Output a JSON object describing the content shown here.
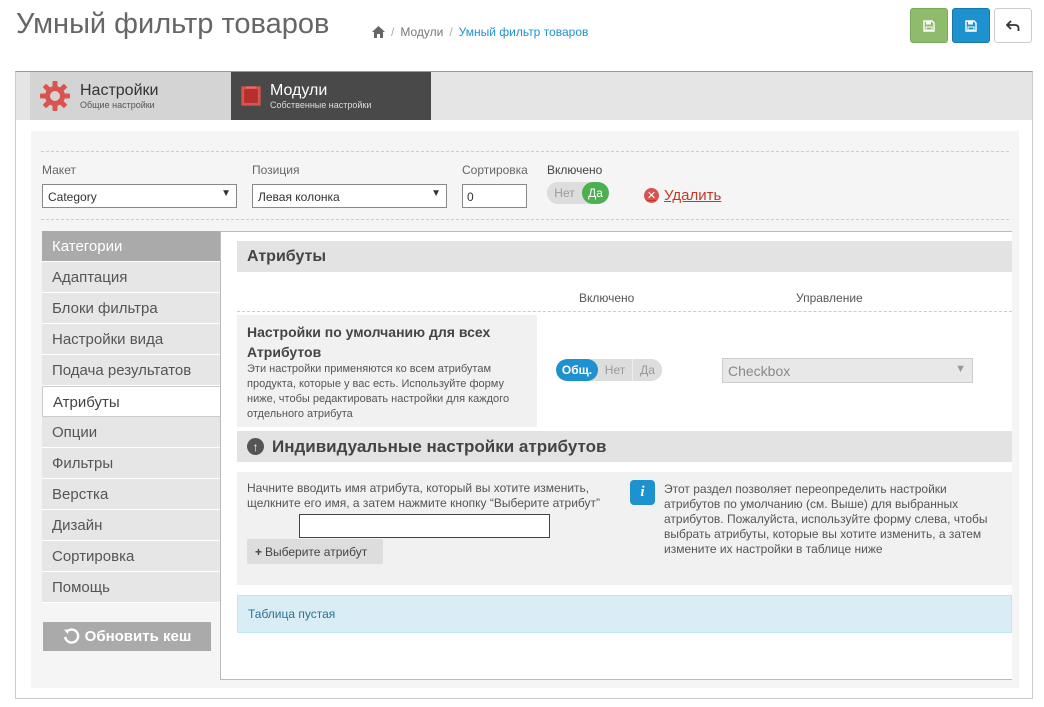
{
  "header": {
    "title": "Умный фильтр товаров",
    "breadcrumb": [
      "Модули",
      "Умный фильтр товаров"
    ]
  },
  "topnav": {
    "settings": {
      "title": "Настройки",
      "subtitle": "Общие настройки"
    },
    "modules": {
      "title": "Модули",
      "subtitle": "Собственные настройки"
    }
  },
  "layout_row": {
    "layout_label": "Макет",
    "layout_value": "Category",
    "position_label": "Позиция",
    "position_value": "Левая колонка",
    "sort_label": "Сортировка",
    "sort_value": "0",
    "enabled_label": "Включено",
    "toggle_no": "Нет",
    "toggle_yes": "Да",
    "delete_label": "Удалить"
  },
  "sidebar": {
    "items": [
      {
        "label": "Категории"
      },
      {
        "label": "Адаптация"
      },
      {
        "label": "Блоки фильтра"
      },
      {
        "label": "Настройки вида"
      },
      {
        "label": "Подача результатов"
      },
      {
        "label": "Атрибуты"
      },
      {
        "label": "Опции"
      },
      {
        "label": "Фильтры"
      },
      {
        "label": "Верстка"
      },
      {
        "label": "Дизайн"
      },
      {
        "label": "Сортировка"
      },
      {
        "label": "Помощь"
      }
    ],
    "active": "Атрибуты",
    "refresh_label": "Обновить кеш"
  },
  "attributes": {
    "title": "Атрибуты",
    "col_enabled": "Включено",
    "col_control": "Управление",
    "defaults_title": "Настройки по умолчанию для всех Атрибутов",
    "defaults_desc": "Эти настройки применяются ко всем атрибутам продукта, которые у вас есть. Используйте форму ниже, чтобы редактировать настройки для каждого отдельного атрибута",
    "toggle_common": "Общ.",
    "toggle_no": "Нет",
    "toggle_yes": "Да",
    "control_value": "Checkbox"
  },
  "individual": {
    "title": "Индивидуальные настройки атрибутов",
    "instructions": "Начните вводить имя атрибута, который вы хотите изменить, щелкните его имя, а затем нажмите кнопку “Выберите атрибут”",
    "choose_button": "Выберите атрибут",
    "info_text": "Этот раздел позволяет переопределить настройки атрибутов по умолчанию (см. Выше) для выбранных атрибутов. Пожалуйста, используйте форму слева, чтобы выбрать атрибуты, которые вы хотите изменить, а затем измените их настройки в таблице ниже",
    "empty_table": "Таблица пустая"
  },
  "colors": {
    "primary": "#1e91cf",
    "success": "#8fbb6c",
    "danger": "#d9534f",
    "toggle_green": "#4caf50"
  },
  "icons": [
    "home-icon",
    "save-icon",
    "undo-icon",
    "gear-icon",
    "puzzle-icon",
    "close-icon",
    "arrow-up-icon",
    "info-icon",
    "plus-icon",
    "refresh-icon"
  ]
}
